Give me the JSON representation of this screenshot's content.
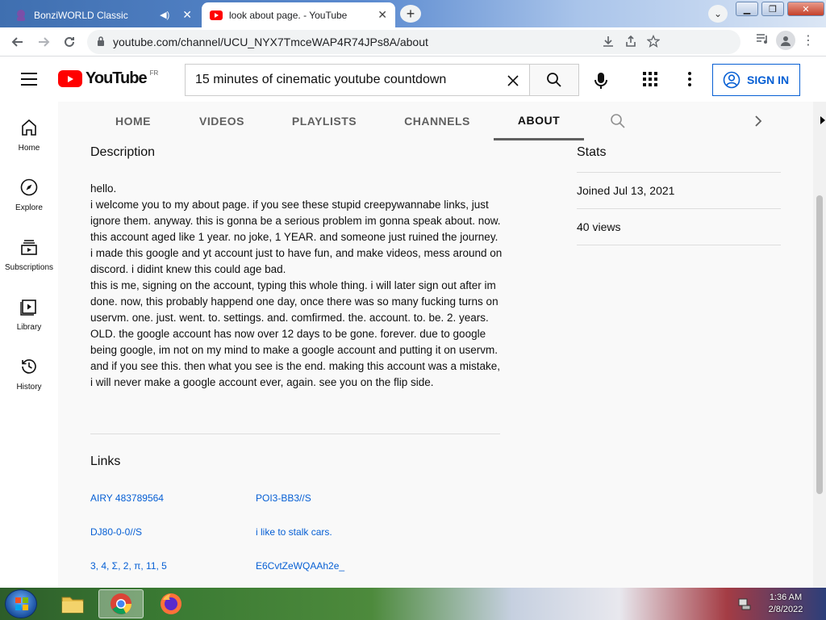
{
  "browser": {
    "tabs": [
      {
        "title": "BonziWORLD Classic",
        "active": false
      },
      {
        "title": "look about page. - YouTube",
        "active": true
      }
    ],
    "url": "youtube.com/channel/UCU_NYX7TmceWAP4R74JPs8A/about"
  },
  "masthead": {
    "logo_text": "YouTube",
    "country_code": "FR",
    "search_value": "15 minutes of cinematic youtube countdown",
    "signin_label": "SIGN IN"
  },
  "guide": {
    "items": [
      {
        "label": "Home",
        "icon": "home-icon"
      },
      {
        "label": "Explore",
        "icon": "compass-icon"
      },
      {
        "label": "Subscriptions",
        "icon": "subscriptions-icon"
      },
      {
        "label": "Library",
        "icon": "library-icon"
      },
      {
        "label": "History",
        "icon": "history-icon"
      }
    ]
  },
  "channel_tabs": {
    "items": [
      "HOME",
      "VIDEOS",
      "PLAYLISTS",
      "CHANNELS",
      "ABOUT"
    ],
    "active": "ABOUT"
  },
  "about": {
    "description_title": "Description",
    "description_lines": [
      "hello.",
      "i welcome you to my about page. if you see these stupid creepywannabe links, just ignore them. anyway. this is gonna be a serious problem im gonna speak about. now. this account aged like 1 year. no joke, 1 YEAR. and someone just ruined the journey. i made this google and yt account just to have fun, and make videos, mess around on discord. i didint knew this could age bad.",
      "this is me, signing on the account, typing this whole thing. i will later sign out after im done. now, this probably happend one day, once there was so many fucking turns on uservm. one. just. went. to. settings. and. comfirmed. the. account. to. be. 2. years. OLD. the google account has now over 12 days to be gone. forever. due to google being google, im not on my mind to make a google account and putting it on uservm. and if you see this. then what you see is the end. making this account was a mistake, i will never make a google account ever, again. see you on the flip side."
    ],
    "links_title": "Links",
    "links": [
      "AIRY 483789564",
      "POI3-BB3//S",
      "DJ80-0-0//S",
      "i like to stalk cars.",
      "3, 4, Σ, 2, π, 11, 5",
      "E6CvtZeWQAAh2e_"
    ],
    "stats_title": "Stats",
    "joined": "Joined Jul 13, 2021",
    "views": "40 views"
  },
  "taskbar": {
    "time": "1:36 AM",
    "date": "2/8/2022"
  },
  "colors": {
    "accent": "#065fd4",
    "youtube_red": "#ff0000"
  }
}
